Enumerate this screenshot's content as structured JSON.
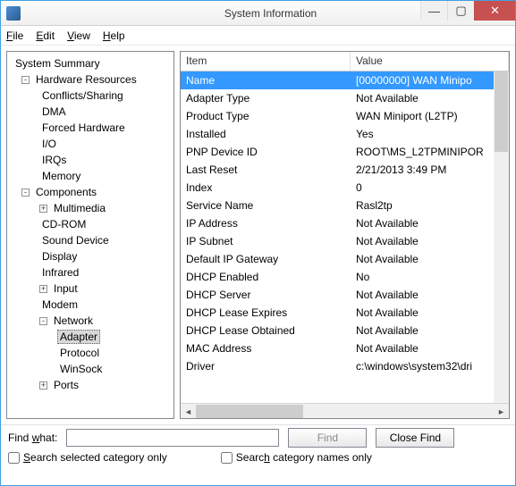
{
  "window": {
    "title": "System Information"
  },
  "menu": {
    "file": "File",
    "edit": "Edit",
    "view": "View",
    "help": "Help"
  },
  "tree": {
    "root": "System Summary",
    "hw": "Hardware Resources",
    "hw_items": [
      "Conflicts/Sharing",
      "DMA",
      "Forced Hardware",
      "I/O",
      "IRQs",
      "Memory"
    ],
    "comp": "Components",
    "comp_items": [
      "Multimedia",
      "CD-ROM",
      "Sound Device",
      "Display",
      "Infrared",
      "Input",
      "Modem"
    ],
    "network": "Network",
    "network_items": [
      "Adapter",
      "Protocol",
      "WinSock"
    ],
    "ports": "Ports"
  },
  "grid": {
    "col_item": "Item",
    "col_value": "Value",
    "rows": [
      {
        "item": "Name",
        "value": "[00000000] WAN Minipo",
        "sel": true
      },
      {
        "item": "Adapter Type",
        "value": "Not Available"
      },
      {
        "item": "Product Type",
        "value": "WAN Miniport (L2TP)"
      },
      {
        "item": "Installed",
        "value": "Yes"
      },
      {
        "item": "PNP Device ID",
        "value": "ROOT\\MS_L2TPMINIPOR"
      },
      {
        "item": "Last Reset",
        "value": "2/21/2013 3:49 PM"
      },
      {
        "item": "Index",
        "value": "0"
      },
      {
        "item": "Service Name",
        "value": "Rasl2tp"
      },
      {
        "item": "IP Address",
        "value": "Not Available"
      },
      {
        "item": "IP Subnet",
        "value": "Not Available"
      },
      {
        "item": "Default IP Gateway",
        "value": "Not Available"
      },
      {
        "item": "DHCP Enabled",
        "value": "No"
      },
      {
        "item": "DHCP Server",
        "value": "Not Available"
      },
      {
        "item": "DHCP Lease Expires",
        "value": "Not Available"
      },
      {
        "item": "DHCP Lease Obtained",
        "value": "Not Available"
      },
      {
        "item": "MAC Address",
        "value": "Not Available"
      },
      {
        "item": "Driver",
        "value": "c:\\windows\\system32\\dri"
      }
    ]
  },
  "find": {
    "label_prefix": "Find ",
    "label_ul": "w",
    "label_suffix": "hat:",
    "value": "",
    "find_btn": "Find",
    "close_btn": "Close Find",
    "close_ul": "C",
    "close_after": "lose Find",
    "chk1_ul": "S",
    "chk1_after": "earch selected category only",
    "chk2_prefix": "Searc",
    "chk2_ul": "h",
    "chk2_after": " category names only"
  }
}
